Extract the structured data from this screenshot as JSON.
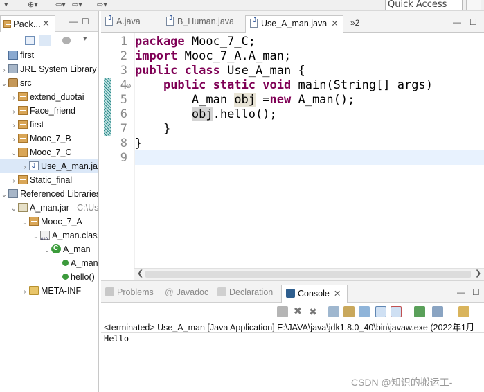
{
  "toolbar": {
    "quick_access_placeholder": "Quick Access"
  },
  "package_explorer": {
    "tab_label": "Pack...",
    "close": "✕",
    "min": "—",
    "max": "☐",
    "tree": [
      {
        "label": "first",
        "arrow": "",
        "icon": "project-icon",
        "depth": 0
      },
      {
        "label": "JRE System Library",
        "arrow": ">",
        "icon": "library-icon",
        "depth": 0
      },
      {
        "label": "src",
        "arrow": "v",
        "icon": "source-folder-icon",
        "depth": 0
      },
      {
        "label": "extend_duotai",
        "arrow": ">",
        "icon": "package-icon",
        "depth": 1
      },
      {
        "label": "Face_friend",
        "arrow": ">",
        "icon": "package-icon",
        "depth": 1
      },
      {
        "label": "first",
        "arrow": ">",
        "icon": "package-icon",
        "depth": 1
      },
      {
        "label": "Mooc_7_B",
        "arrow": ">",
        "icon": "package-icon",
        "depth": 1
      },
      {
        "label": "Mooc_7_C",
        "arrow": "v",
        "icon": "package-icon",
        "depth": 1
      },
      {
        "label": "Use_A_man.java",
        "arrow": ">",
        "icon": "java-file-icon",
        "depth": 2,
        "selected": true
      },
      {
        "label": "Static_final",
        "arrow": ">",
        "icon": "package-icon",
        "depth": 1
      },
      {
        "label": "Referenced Libraries",
        "arrow": "v",
        "icon": "library-icon",
        "depth": 0
      },
      {
        "label": "A_man.jar",
        "dim": " - C:\\Us",
        "arrow": "v",
        "icon": "jar-icon",
        "depth": 1
      },
      {
        "label": "Mooc_7_A",
        "arrow": "v",
        "icon": "package-icon",
        "depth": 2
      },
      {
        "label": "A_man.class",
        "arrow": "v",
        "icon": "class-file-icon",
        "depth": 3
      },
      {
        "label": "A_man",
        "arrow": "v",
        "icon": "class-icon",
        "depth": 4
      },
      {
        "label": "A_man",
        "arrow": "",
        "icon": "constructor-icon",
        "depth": 5
      },
      {
        "label": "hello()",
        "arrow": "",
        "icon": "method-icon",
        "depth": 5
      },
      {
        "label": "META-INF",
        "arrow": ">",
        "icon": "folder-icon",
        "depth": 2
      }
    ]
  },
  "editor": {
    "tabs": [
      {
        "label": "A.java",
        "active": false
      },
      {
        "label": "B_Human.java",
        "active": false
      },
      {
        "label": "Use_A_man.java",
        "active": true
      }
    ],
    "overflow_label": "»2",
    "min": "—",
    "max": "☐",
    "line_numbers": [
      "1",
      "2",
      "3",
      "4",
      "5",
      "6",
      "7",
      "8",
      "9"
    ],
    "fold_marker": "⊖",
    "code": {
      "l1_kw": "package",
      "l1_rest": " Mooc_7_C;",
      "l2_kw": "import",
      "l2_rest": " Mooc_7_A.A_man;",
      "l3_kw1": "public",
      "l3_kw2": "class",
      "l3_rest": " Use_A_man {",
      "l4_kw1": "public",
      "l4_kw2": "static",
      "l4_kw3": "void",
      "l4_rest": " main(String[] args)",
      "l5_a": "A_man ",
      "l5_var": "obj",
      "l5_b": " =",
      "l5_kw": "new",
      "l5_c": " A_man();",
      "l6_var": "obj",
      "l6_rest": ".hello();",
      "l7": "}",
      "l8": "}"
    }
  },
  "console": {
    "tabs": [
      {
        "label": "Problems",
        "active": false
      },
      {
        "label": "Javadoc",
        "active": false
      },
      {
        "label": "Declaration",
        "active": false
      },
      {
        "label": "Console",
        "active": true
      }
    ],
    "close": "✕",
    "min": "—",
    "max": "☐",
    "header": "<terminated> Use_A_man [Java Application] E:\\JAVA\\java\\jdk1.8.0_40\\bin\\javaw.exe (2022年1月",
    "output": "Hello"
  },
  "watermark": "CSDN @知识的搬运工-"
}
